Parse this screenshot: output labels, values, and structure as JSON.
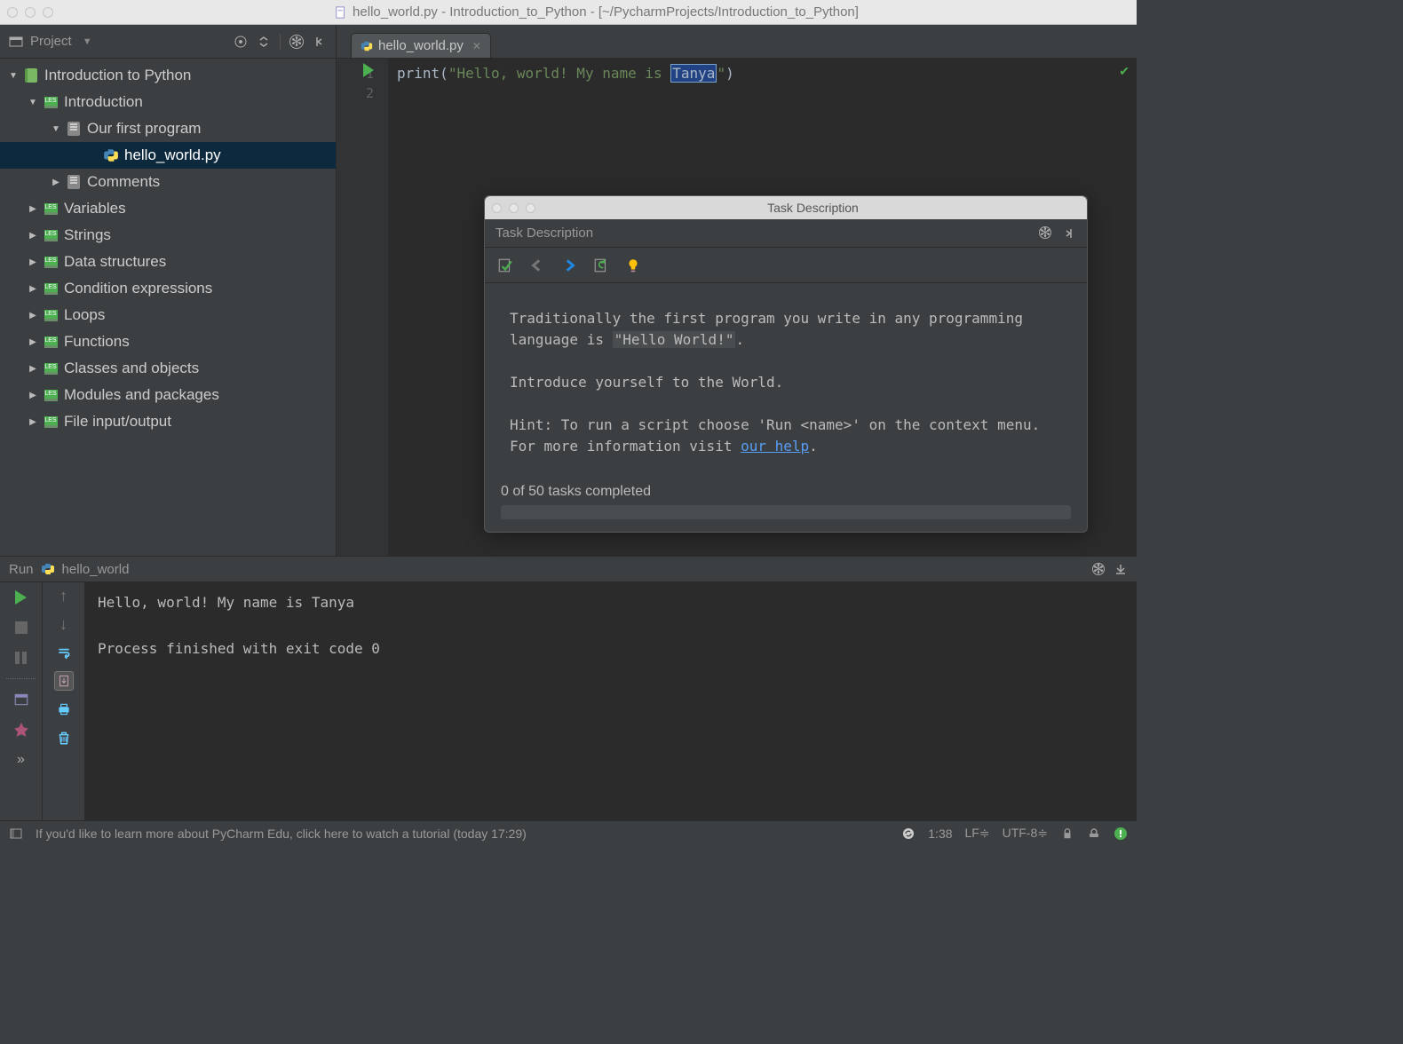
{
  "window": {
    "title": "hello_world.py - Introduction_to_Python - [~/PycharmProjects/Introduction_to_Python]"
  },
  "project": {
    "panel_label": "Project",
    "root": "Introduction to Python",
    "tree": {
      "root": "Introduction to Python",
      "intro": "Introduction",
      "our_first": "Our first program",
      "hello_world": "hello_world.py",
      "comments": "Comments",
      "variables": "Variables",
      "strings": "Strings",
      "data_structures": "Data structures",
      "condition": "Condition expressions",
      "loops": "Loops",
      "functions": "Functions",
      "classes": "Classes and objects",
      "modules": "Modules and packages",
      "fileio": "File input/output"
    }
  },
  "editor": {
    "tab_name": "hello_world.py",
    "gutter": [
      "1",
      "2"
    ],
    "code": {
      "fn": "print",
      "open": "(",
      "str1": "\"Hello, world! My name is ",
      "sel": "Tanya",
      "str2": "\"",
      "close": ")"
    }
  },
  "run": {
    "label": "Run",
    "config": "hello_world",
    "output_line1": "Hello, world! My name is Tanya",
    "output_line2": "Process finished with exit code 0"
  },
  "task": {
    "title": "Task Description",
    "subheader": "Task Description",
    "body1": "Traditionally the first program you write in any programming language is ",
    "body1_hl": "\"Hello World!\"",
    "body1_end": ".",
    "body2": "Introduce yourself to the World.",
    "body3": "Hint: To run a script choose 'Run <name>' on the context menu.",
    "body4a": "For more information visit ",
    "body4_link": "our help",
    "body4b": ".",
    "progress": "0 of 50 tasks completed"
  },
  "status": {
    "msg": "If you'd like to learn more about PyCharm Edu, click here to watch a tutorial (today 17:29)",
    "pos": "1:38",
    "lf": "LF",
    "enc": "UTF-8"
  }
}
